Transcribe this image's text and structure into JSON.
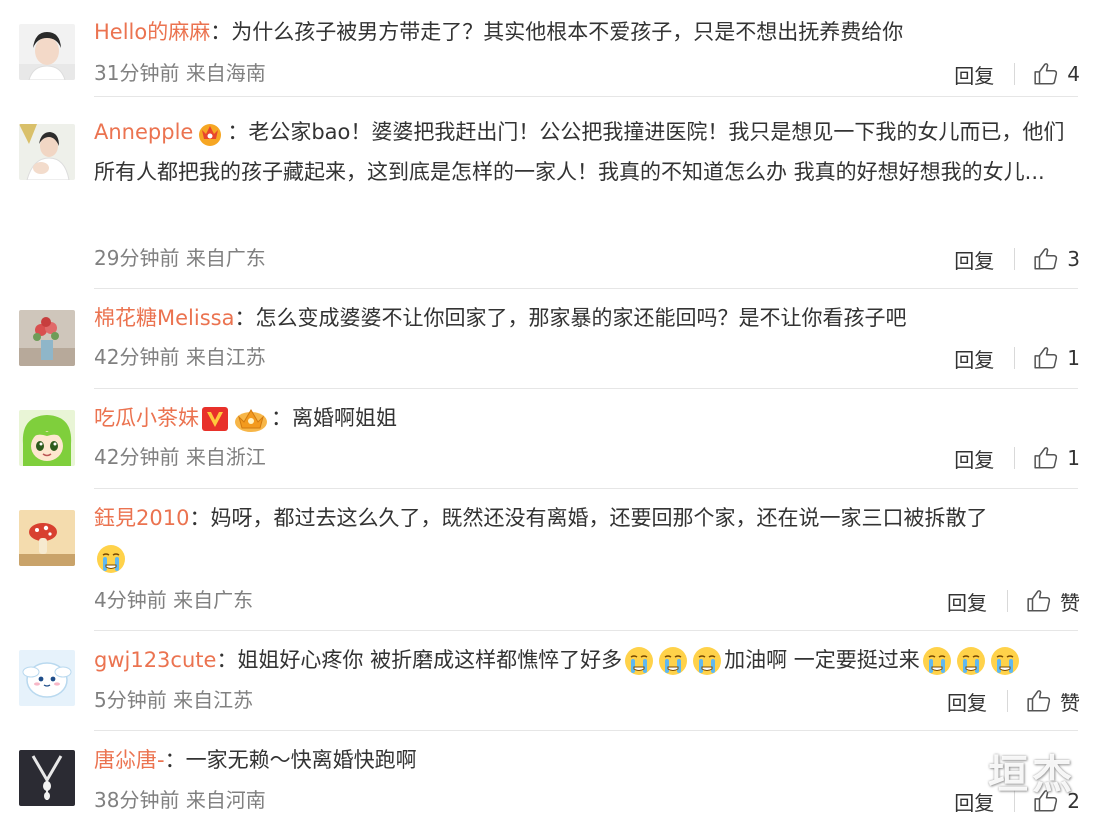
{
  "comments": [
    {
      "username": "Hello的麻麻",
      "text": "：为什么孩子被男方带走了？其实他根本不爱孩子，只是不想出抚养费给你",
      "time": "31分钟前",
      "source": "来自海南",
      "reply": "回复",
      "likes": "4"
    },
    {
      "username": "Annepple",
      "text": "：老公家bao！婆婆把我赶出门！公公把我撞进医院！我只是想见一下我的女儿而已，他们所有人都把我的孩子藏起来，这到底是怎样的一家人！我真的不知道怎么办 我真的好想好想我的女儿...",
      "time": "29分钟前",
      "source": "来自广东",
      "reply": "回复",
      "likes": "3"
    },
    {
      "username": "棉花糖Melissa",
      "text": "：怎么变成婆婆不让你回家了，那家暴的家还能回吗？是不让你看孩子吧",
      "time": "42分钟前",
      "source": "来自江苏",
      "reply": "回复",
      "likes": "1"
    },
    {
      "username": "吃瓜小茶妹",
      "text": "：离婚啊姐姐",
      "time": "42分钟前",
      "source": "来自浙江",
      "reply": "回复",
      "likes": "1"
    },
    {
      "username": "鈺見2010",
      "text": "：妈呀，都过去这么久了，既然还没有离婚，还要回那个家，还在说一家三口被拆散了",
      "time": "4分钟前",
      "source": "来自广东",
      "reply": "回复",
      "likes": "赞"
    },
    {
      "username": "gwj123cute",
      "text_a": "：姐姐好心疼你 被折磨成这样都憔悴了好多",
      "text_b": "加油啊 一定要挺过来",
      "time": "5分钟前",
      "source": "来自江苏",
      "reply": "回复",
      "likes": "赞"
    },
    {
      "username": "唐尛唐-",
      "text": "：一家无赖～快离婚快跑啊",
      "time": "38分钟前",
      "source": "来自河南",
      "reply": "回复",
      "likes": "2"
    }
  ],
  "watermark": "垣杰",
  "colors": {
    "username": "#eb7350",
    "text": "#333333",
    "meta": "#808080",
    "divider": "#e6e6e6"
  },
  "icons": {
    "like": "thumbs-up-icon",
    "vip_badge": "vip-v-badge-icon",
    "crown_badge": "crown-badge-icon",
    "emoji_cry": "crying-face-emoji-icon"
  }
}
